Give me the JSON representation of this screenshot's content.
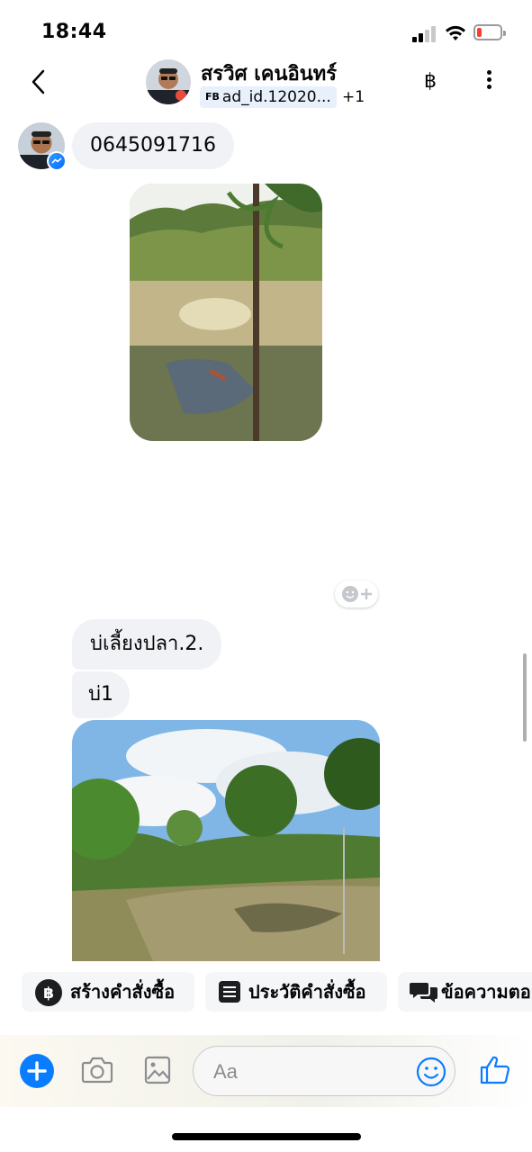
{
  "status_bar": {
    "time": "18:44"
  },
  "header": {
    "contact_name": "สรวิศ เคนอินทร์",
    "tag_source": "FB",
    "tag_label": "ad_id.12020...",
    "tag_extra": "+1",
    "baht_symbol": "฿"
  },
  "messages": {
    "phone": "0645091716",
    "fish_pond": "บ่เลี้ยงปลา.2.",
    "well": "บ่1"
  },
  "quick_actions": [
    {
      "label": "สร้างคำสั่งซื้อ",
      "icon": "baht-circle-icon"
    },
    {
      "label": "ประวัติคำสั่งซื้อ",
      "icon": "document-list-icon"
    },
    {
      "label": "ข้อความตอ",
      "icon": "chat-bubbles-icon"
    }
  ],
  "composer": {
    "placeholder": "Aa"
  },
  "colors": {
    "accent": "#0a7cff",
    "bubble": "#f0f2f5",
    "battery_low": "#ff3b30"
  }
}
